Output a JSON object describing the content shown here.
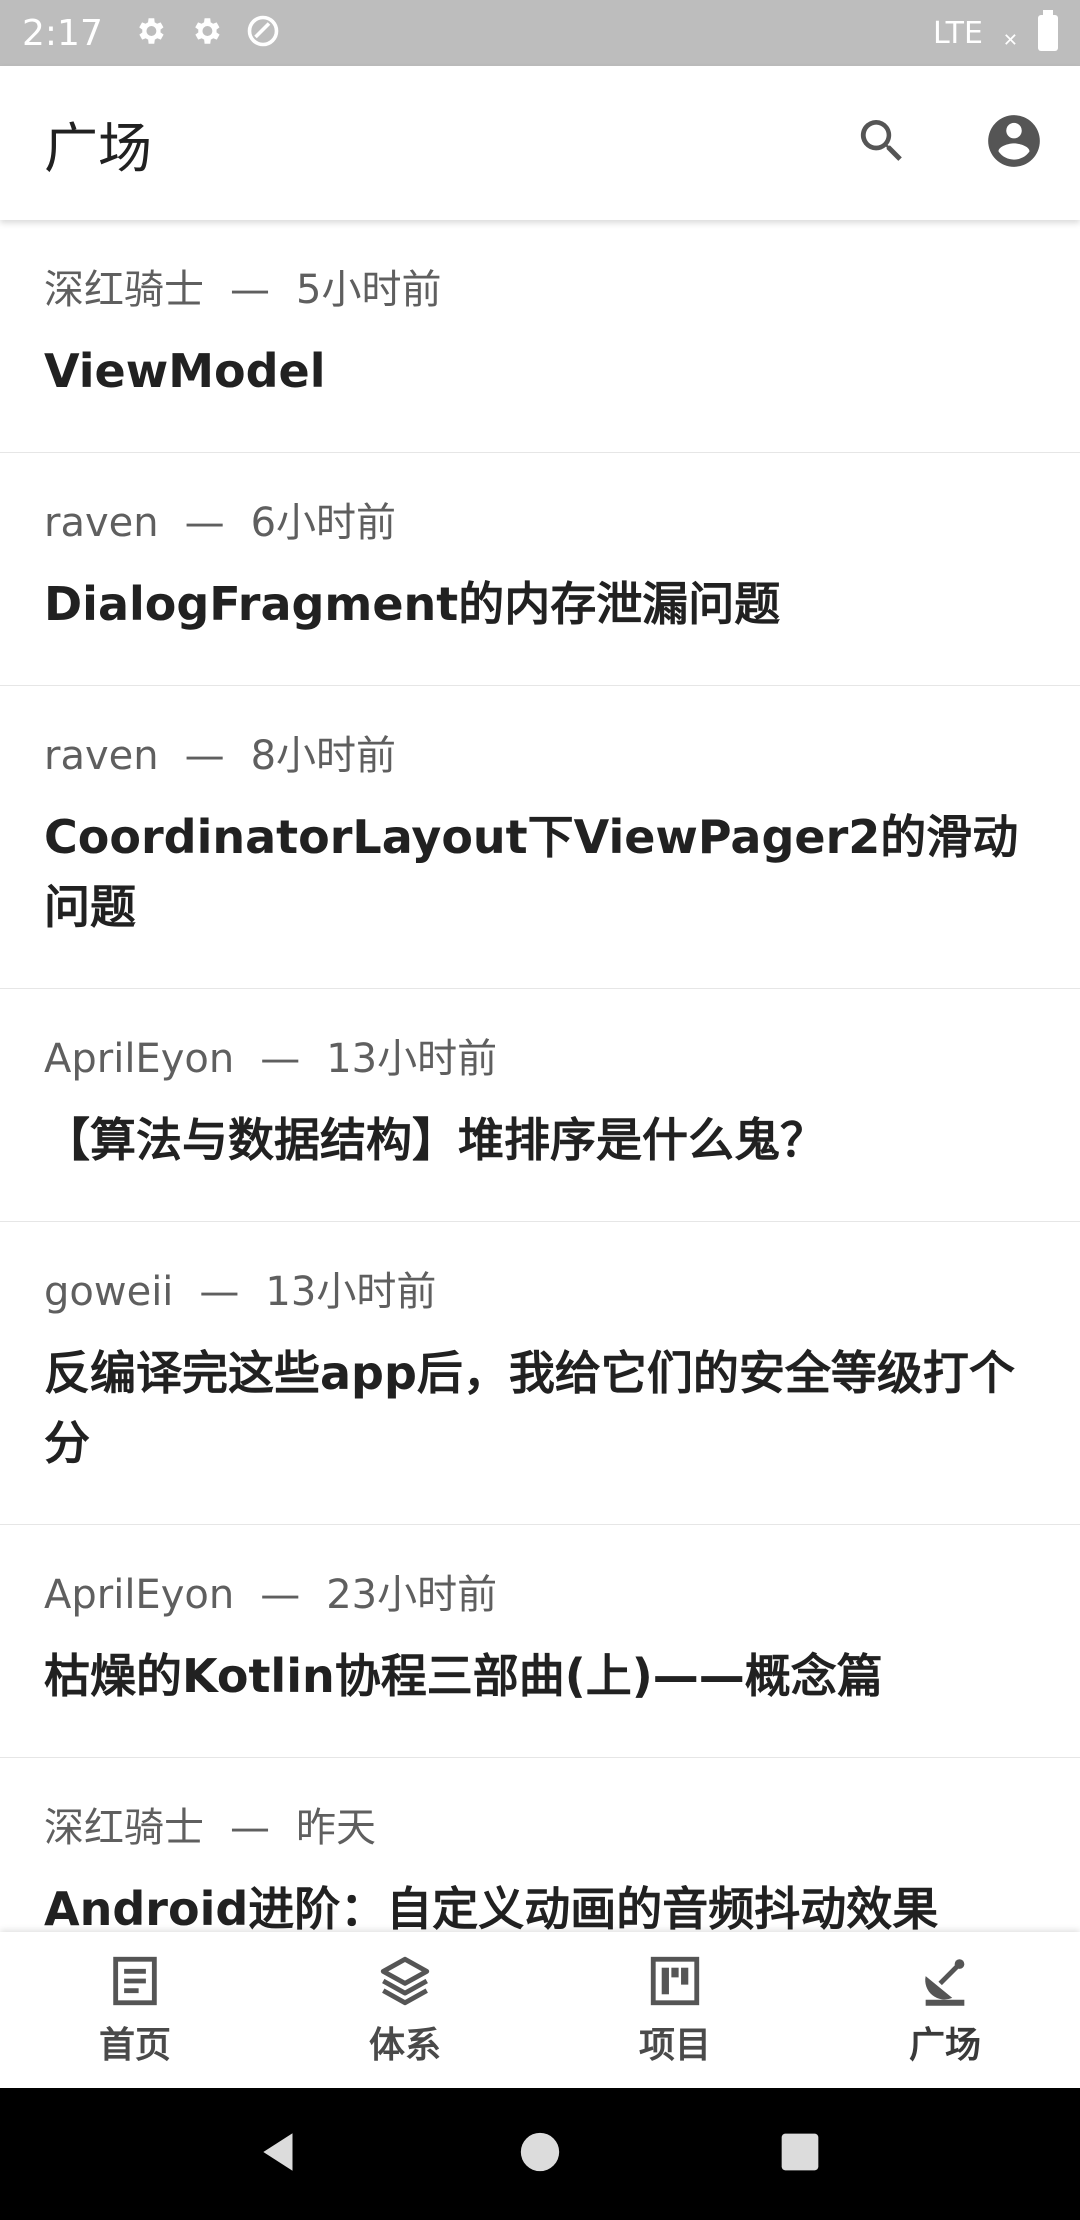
{
  "status_bar": {
    "time": "2:17",
    "network": "LTE",
    "icons": [
      "settings-icon",
      "settings-icon",
      "data-saver-icon",
      "signal-icon",
      "battery-icon"
    ]
  },
  "app_bar": {
    "title": "广场",
    "actions": [
      "search-icon",
      "account-circle-icon"
    ]
  },
  "feed": {
    "items": [
      {
        "author": "深红骑士",
        "time": "5小时前",
        "title": "ViewModel"
      },
      {
        "author": "raven",
        "time": "6小时前",
        "title": "DialogFragment的内存泄漏问题"
      },
      {
        "author": "raven",
        "time": "8小时前",
        "title": "CoordinatorLayout下ViewPager2的滑动问题"
      },
      {
        "author": "AprilEyon",
        "time": "13小时前",
        "title": "【算法与数据结构】堆排序是什么鬼？"
      },
      {
        "author": "goweii",
        "time": "13小时前",
        "title": "反编译完这些app后，我给它们的安全等级打个分"
      },
      {
        "author": "AprilEyon",
        "time": "23小时前",
        "title": "枯燥的Kotlin协程三部曲(上)——概念篇"
      },
      {
        "author": "深红骑士",
        "time": "昨天",
        "title": "Android进阶：自定义动画的音频抖动效果"
      }
    ],
    "separator": "—"
  },
  "bottom_nav": {
    "items": [
      {
        "label": "首页",
        "icon": "article-icon"
      },
      {
        "label": "体系",
        "icon": "layers-icon"
      },
      {
        "label": "项目",
        "icon": "board-icon"
      },
      {
        "label": "广场",
        "icon": "satellite-dish-icon"
      }
    ],
    "active_index": 3
  },
  "colors": {
    "status_bar": "#bdbdbd",
    "title_text": "#212121",
    "meta_text": "#5f5f5f",
    "nav_icon": "#555555"
  }
}
